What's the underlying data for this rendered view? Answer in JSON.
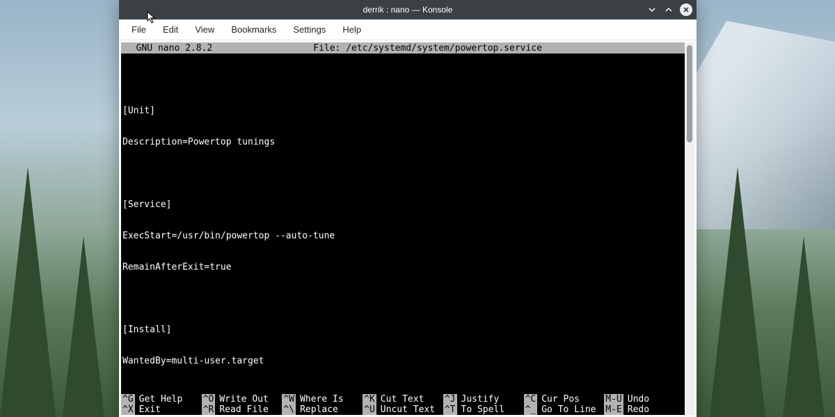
{
  "window": {
    "title": "derrik : nano — Konsole"
  },
  "menubar": {
    "items": [
      "File",
      "Edit",
      "View",
      "Bookmarks",
      "Settings",
      "Help"
    ]
  },
  "nano": {
    "version": "  GNU nano 2.8.2",
    "file_label": "File: /etc/systemd/system/powertop.service",
    "lines": [
      "[Unit]",
      "Description=Powertop tunings",
      "",
      "[Service]",
      "ExecStart=/usr/bin/powertop --auto-tune",
      "RemainAfterExit=true",
      "",
      "[Install]",
      "WantedBy=multi-user.target"
    ],
    "footer": [
      {
        "key": "^G",
        "label": "Get Help"
      },
      {
        "key": "^O",
        "label": "Write Out"
      },
      {
        "key": "^W",
        "label": "Where Is"
      },
      {
        "key": "^K",
        "label": "Cut Text"
      },
      {
        "key": "^J",
        "label": "Justify"
      },
      {
        "key": "^C",
        "label": "Cur Pos"
      },
      {
        "key": "M-U",
        "label": "Undo"
      },
      {
        "key": "^X",
        "label": "Exit"
      },
      {
        "key": "^R",
        "label": "Read File"
      },
      {
        "key": "^\\",
        "label": "Replace"
      },
      {
        "key": "^U",
        "label": "Uncut Text"
      },
      {
        "key": "^T",
        "label": "To Spell"
      },
      {
        "key": "^_",
        "label": "Go To Line"
      },
      {
        "key": "M-E",
        "label": "Redo"
      }
    ]
  }
}
